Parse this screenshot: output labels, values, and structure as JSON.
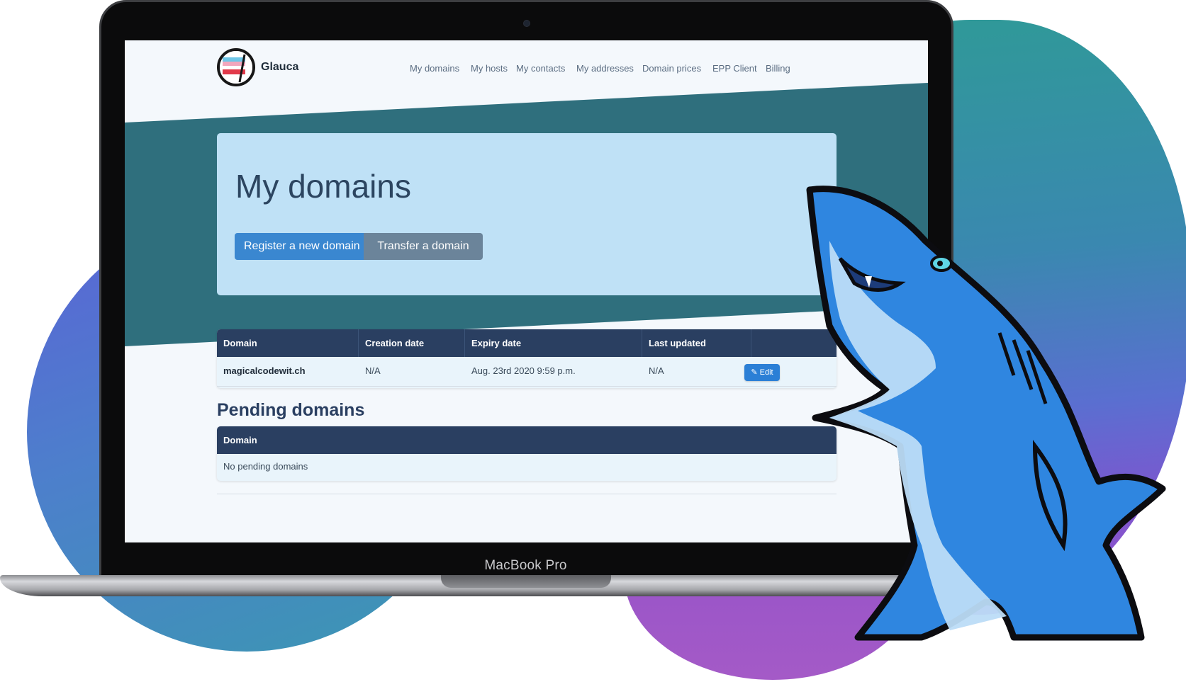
{
  "device": {
    "label": "MacBook Pro"
  },
  "navbar": {
    "brand": "Glauca",
    "links": [
      "My domains",
      "My hosts",
      "My contacts",
      "My addresses",
      "Domain prices",
      "EPP Client",
      "Billing"
    ]
  },
  "jumbotron": {
    "title": "My domains",
    "register_label": "Register a new domain",
    "transfer_label": "Transfer a domain"
  },
  "domains_table": {
    "headers": [
      "Domain",
      "Creation date",
      "Expiry date",
      "Last updated",
      ""
    ],
    "rows": [
      {
        "domain": "magicalcodewit.ch",
        "creation_date": "N/A",
        "expiry_date": "Aug. 23rd 2020 9:59 p.m.",
        "last_updated": "N/A",
        "edit_label": "Edit"
      }
    ]
  },
  "pending": {
    "heading": "Pending domains",
    "header": "Domain",
    "empty_text": "No pending domains"
  },
  "colors": {
    "navy": "#2a3f61",
    "teal_band": "#2f6f7d",
    "jumbotron": "#bfe1f6",
    "primary": "#3a87d0",
    "secondary": "#6b849a"
  },
  "icons": {
    "edit": "pencil-icon",
    "brand": "flag-logo-icon",
    "mascot": "shark-mascot"
  }
}
